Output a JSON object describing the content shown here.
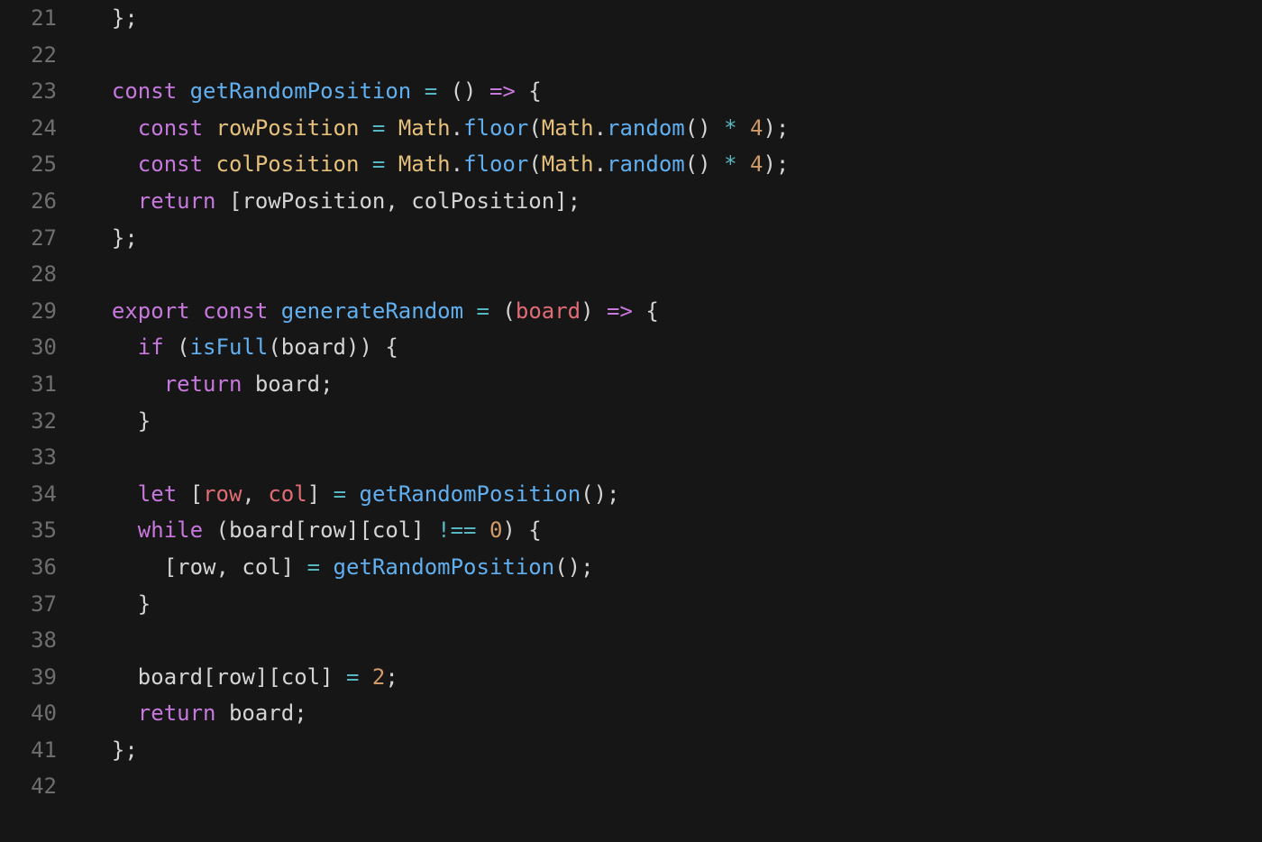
{
  "lines": [
    {
      "number": "21",
      "tokens": [
        {
          "t": "plain",
          "v": "  };"
        }
      ]
    },
    {
      "number": "22",
      "tokens": [
        {
          "t": "plain",
          "v": ""
        }
      ]
    },
    {
      "number": "23",
      "tokens": [
        {
          "t": "plain",
          "v": "  "
        },
        {
          "t": "kw",
          "v": "const"
        },
        {
          "t": "plain",
          "v": " "
        },
        {
          "t": "fn",
          "v": "getRandomPosition"
        },
        {
          "t": "plain",
          "v": " "
        },
        {
          "t": "op",
          "v": "="
        },
        {
          "t": "plain",
          "v": " () "
        },
        {
          "t": "kw",
          "v": "=>"
        },
        {
          "t": "plain",
          "v": " {"
        }
      ]
    },
    {
      "number": "24",
      "tokens": [
        {
          "t": "plain",
          "v": "    "
        },
        {
          "t": "kw",
          "v": "const"
        },
        {
          "t": "plain",
          "v": " "
        },
        {
          "t": "const-name",
          "v": "rowPosition"
        },
        {
          "t": "plain",
          "v": " "
        },
        {
          "t": "op",
          "v": "="
        },
        {
          "t": "plain",
          "v": " "
        },
        {
          "t": "obj",
          "v": "Math"
        },
        {
          "t": "plain",
          "v": "."
        },
        {
          "t": "method",
          "v": "floor"
        },
        {
          "t": "plain",
          "v": "("
        },
        {
          "t": "obj",
          "v": "Math"
        },
        {
          "t": "plain",
          "v": "."
        },
        {
          "t": "method",
          "v": "random"
        },
        {
          "t": "plain",
          "v": "() "
        },
        {
          "t": "op",
          "v": "*"
        },
        {
          "t": "plain",
          "v": " "
        },
        {
          "t": "num",
          "v": "4"
        },
        {
          "t": "plain",
          "v": ");"
        }
      ]
    },
    {
      "number": "25",
      "tokens": [
        {
          "t": "plain",
          "v": "    "
        },
        {
          "t": "kw",
          "v": "const"
        },
        {
          "t": "plain",
          "v": " "
        },
        {
          "t": "const-name",
          "v": "colPosition"
        },
        {
          "t": "plain",
          "v": " "
        },
        {
          "t": "op",
          "v": "="
        },
        {
          "t": "plain",
          "v": " "
        },
        {
          "t": "obj",
          "v": "Math"
        },
        {
          "t": "plain",
          "v": "."
        },
        {
          "t": "method",
          "v": "floor"
        },
        {
          "t": "plain",
          "v": "("
        },
        {
          "t": "obj",
          "v": "Math"
        },
        {
          "t": "plain",
          "v": "."
        },
        {
          "t": "method",
          "v": "random"
        },
        {
          "t": "plain",
          "v": "() "
        },
        {
          "t": "op",
          "v": "*"
        },
        {
          "t": "plain",
          "v": " "
        },
        {
          "t": "num",
          "v": "4"
        },
        {
          "t": "plain",
          "v": ");"
        }
      ]
    },
    {
      "number": "26",
      "tokens": [
        {
          "t": "plain",
          "v": "    "
        },
        {
          "t": "kw",
          "v": "return"
        },
        {
          "t": "plain",
          "v": " [rowPosition, colPosition];"
        }
      ]
    },
    {
      "number": "27",
      "tokens": [
        {
          "t": "plain",
          "v": "  };"
        }
      ]
    },
    {
      "number": "28",
      "tokens": [
        {
          "t": "plain",
          "v": ""
        }
      ]
    },
    {
      "number": "29",
      "tokens": [
        {
          "t": "plain",
          "v": "  "
        },
        {
          "t": "kw",
          "v": "export"
        },
        {
          "t": "plain",
          "v": " "
        },
        {
          "t": "kw",
          "v": "const"
        },
        {
          "t": "plain",
          "v": " "
        },
        {
          "t": "fn",
          "v": "generateRandom"
        },
        {
          "t": "plain",
          "v": " "
        },
        {
          "t": "op",
          "v": "="
        },
        {
          "t": "plain",
          "v": " ("
        },
        {
          "t": "var",
          "v": "board"
        },
        {
          "t": "plain",
          "v": ") "
        },
        {
          "t": "kw",
          "v": "=>"
        },
        {
          "t": "plain",
          "v": " {"
        }
      ]
    },
    {
      "number": "30",
      "tokens": [
        {
          "t": "plain",
          "v": "    "
        },
        {
          "t": "kw",
          "v": "if"
        },
        {
          "t": "plain",
          "v": " ("
        },
        {
          "t": "fn",
          "v": "isFull"
        },
        {
          "t": "plain",
          "v": "(board)) {"
        }
      ]
    },
    {
      "number": "31",
      "tokens": [
        {
          "t": "plain",
          "v": "      "
        },
        {
          "t": "kw",
          "v": "return"
        },
        {
          "t": "plain",
          "v": " board;"
        }
      ]
    },
    {
      "number": "32",
      "tokens": [
        {
          "t": "plain",
          "v": "    }"
        }
      ]
    },
    {
      "number": "33",
      "tokens": [
        {
          "t": "plain",
          "v": ""
        }
      ]
    },
    {
      "number": "34",
      "tokens": [
        {
          "t": "plain",
          "v": "    "
        },
        {
          "t": "kw",
          "v": "let"
        },
        {
          "t": "plain",
          "v": " ["
        },
        {
          "t": "var",
          "v": "row"
        },
        {
          "t": "plain",
          "v": ", "
        },
        {
          "t": "var",
          "v": "col"
        },
        {
          "t": "plain",
          "v": "] "
        },
        {
          "t": "op",
          "v": "="
        },
        {
          "t": "plain",
          "v": " "
        },
        {
          "t": "fn",
          "v": "getRandomPosition"
        },
        {
          "t": "plain",
          "v": "();"
        }
      ]
    },
    {
      "number": "35",
      "tokens": [
        {
          "t": "plain",
          "v": "    "
        },
        {
          "t": "kw",
          "v": "while"
        },
        {
          "t": "plain",
          "v": " (board[row][col] "
        },
        {
          "t": "op",
          "v": "!=="
        },
        {
          "t": "plain",
          "v": " "
        },
        {
          "t": "num",
          "v": "0"
        },
        {
          "t": "plain",
          "v": ") {"
        }
      ]
    },
    {
      "number": "36",
      "tokens": [
        {
          "t": "plain",
          "v": "      [row, col] "
        },
        {
          "t": "op",
          "v": "="
        },
        {
          "t": "plain",
          "v": " "
        },
        {
          "t": "fn",
          "v": "getRandomPosition"
        },
        {
          "t": "plain",
          "v": "();"
        }
      ]
    },
    {
      "number": "37",
      "tokens": [
        {
          "t": "plain",
          "v": "    }"
        }
      ]
    },
    {
      "number": "38",
      "tokens": [
        {
          "t": "plain",
          "v": ""
        }
      ]
    },
    {
      "number": "39",
      "tokens": [
        {
          "t": "plain",
          "v": "    board[row][col] "
        },
        {
          "t": "op",
          "v": "="
        },
        {
          "t": "plain",
          "v": " "
        },
        {
          "t": "num",
          "v": "2"
        },
        {
          "t": "plain",
          "v": ";"
        }
      ]
    },
    {
      "number": "40",
      "tokens": [
        {
          "t": "plain",
          "v": "    "
        },
        {
          "t": "kw",
          "v": "return"
        },
        {
          "t": "plain",
          "v": " board;"
        }
      ]
    },
    {
      "number": "41",
      "tokens": [
        {
          "t": "plain",
          "v": "  };"
        }
      ]
    },
    {
      "number": "42",
      "tokens": [
        {
          "t": "plain",
          "v": ""
        }
      ]
    }
  ]
}
